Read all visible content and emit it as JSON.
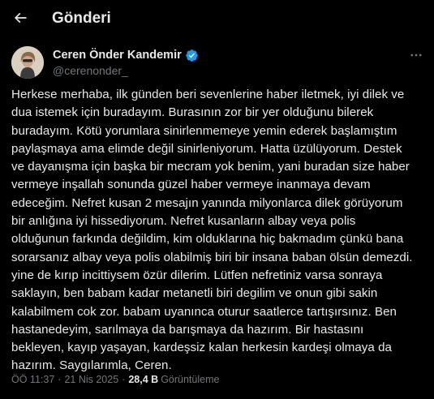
{
  "header": {
    "title": "Gönderi",
    "back_icon": "arrow-left-icon"
  },
  "author": {
    "display_name": "Ceren Önder Kandemir",
    "handle": "@cerenonder_",
    "verified": true,
    "verified_color": "#1d9bf0"
  },
  "tweet": {
    "text": "Herkese merhaba, ilk günden beri sevenlerine haber iletmek, iyi dilek ve\ndua istemek için buradayım. Burasının zor bir yer olduğunu bilerek\nburadayım. Kötü yorumlara sinirlenmemeye yemin ederek başlamıştım\npaylaşmaya ama elimde değil sinirleniyorum. Hatta üzülüyorum. Destek\nve dayanışma için başka bir mecram yok benim, yani buradan size haber\nvermeye inşallah sonunda güzel haber vermeye inanmaya devam\nedeceğim. Nefret kusan 2 mesajın yanında milyonlarca dilek görüyorum\nbir anlığına iyi hissediyorum. Nefret kusanların albay veya polis\nolduğunun farkında değildim, kim olduklarına hiç bakmadım çünkü bana\nsorarsanız albay veya polis olabilmiş biri bir insana baban ölsün demezdi.\nyine de kırıp incittiysem özür dilerim. Lütfen nefretiniz varsa sonraya\nsaklayın, ben babam kadar metanetli biri degilim ve onun gibi sakin\nkalabilmem cok zor. babam uyanınca oturur saatlerce tartışırsınız. Ben\nhastanedeyim, sarılmaya da barışmaya da hazırım. Bir hastasını\nbekleyen, kayıp yaşayan, kardeşsiz kalan herkesin kardeşi olmaya da\nhazırım. Saygılarımla, Ceren."
  },
  "meta": {
    "time": "ÖÖ 11:37",
    "separator": "·",
    "date": "21 Nis 2025",
    "views_count": "28,4 B",
    "views_label": "Görüntüleme"
  },
  "icons": {
    "more": "more-horizontal-icon",
    "avatar": "avatar"
  }
}
